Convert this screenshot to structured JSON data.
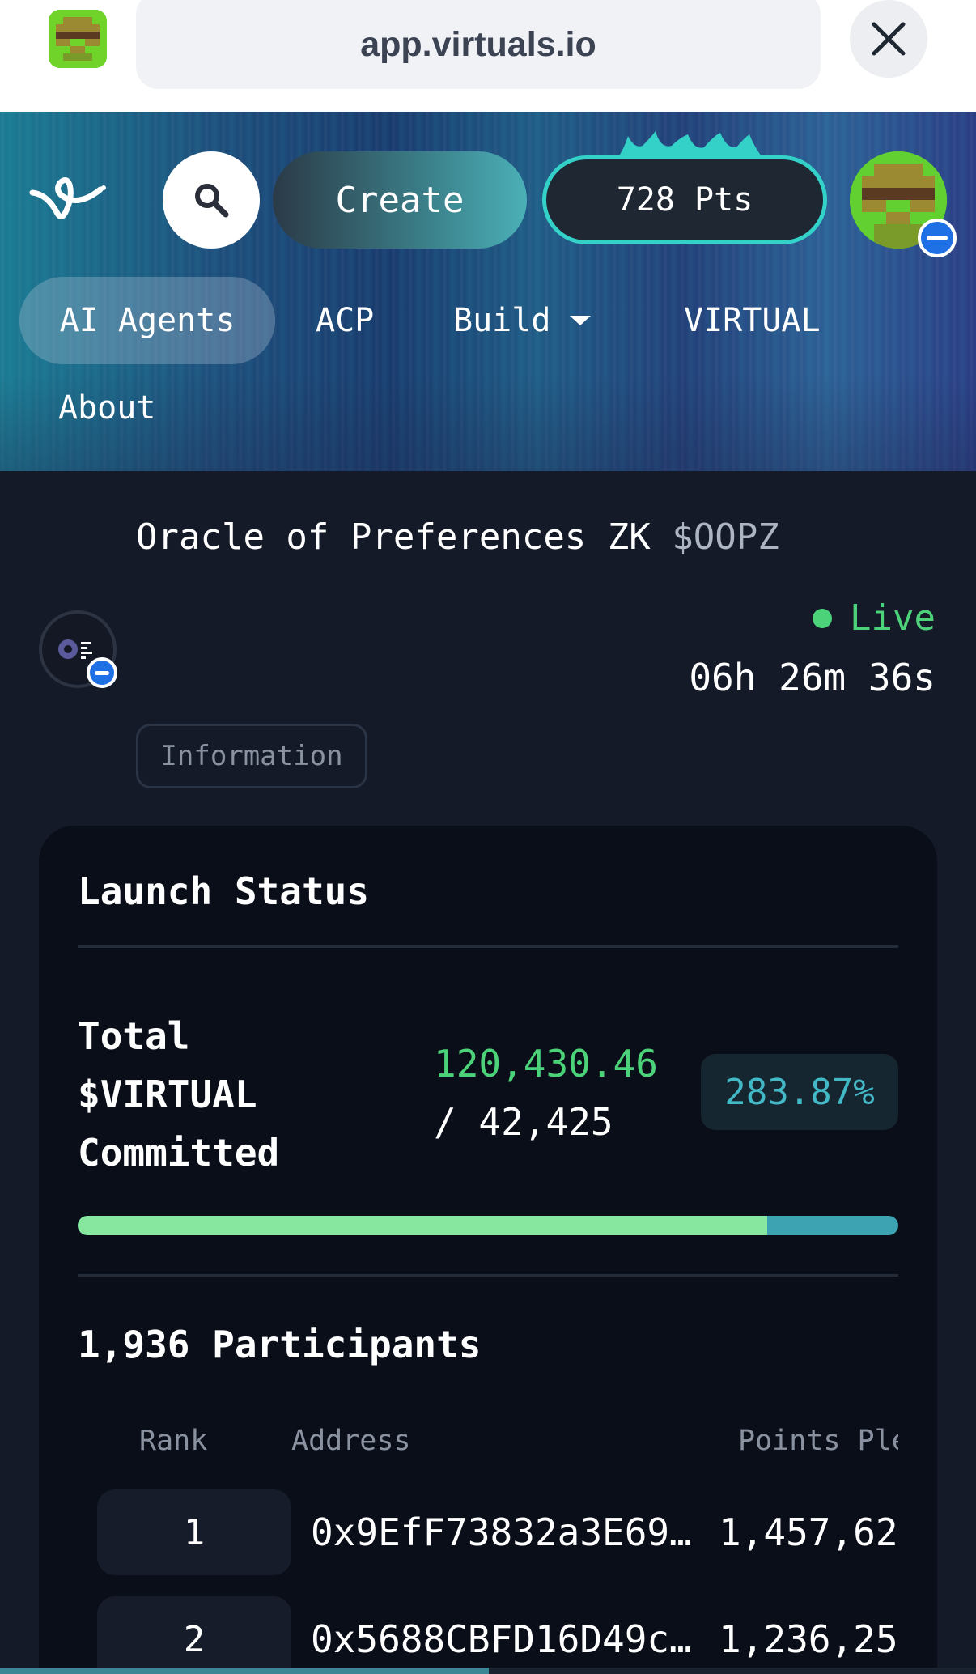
{
  "browser": {
    "url": "app.virtuals.io",
    "close_icon": "close-icon",
    "favicon_icon": "pixel-avatar-icon"
  },
  "header": {
    "logo_icon": "virtuals-logo-icon",
    "search_icon": "search-icon",
    "create_label": "Create",
    "points_label": "728 Pts",
    "avatar_icon": "pixel-avatar-icon",
    "nav": {
      "ai_agents": "AI Agents",
      "acp": "ACP",
      "build": "Build",
      "virtual": "VIRTUAL",
      "about": "About"
    },
    "colors": {
      "points_border": "#34d1c9",
      "create_gradient_end": "#4bb0b7"
    }
  },
  "agent": {
    "name": "Oracle of Preferences ZK",
    "ticker": "$OOPZ",
    "status": "Live",
    "countdown": "06h 26m 36s",
    "info_tab": "Information"
  },
  "launch": {
    "title": "Launch Status",
    "committed_label_lines": [
      "Total",
      "$VIRTUAL",
      "Committed"
    ],
    "committed_amount": "120,430.46",
    "committed_target": "/ 42,425",
    "percent": "283.87%",
    "progress_fraction": 0.84,
    "participants_label": "1,936 Participants",
    "table": {
      "headers": [
        "Rank",
        "Address",
        "Points Ple"
      ],
      "rows": [
        {
          "rank": "1",
          "address": "0x9EfF73832a3E69…",
          "points": "1,457,62"
        },
        {
          "rank": "2",
          "address": "0x5688CBFD16D49c…",
          "points": "1,236,25"
        }
      ]
    },
    "colors": {
      "live": "#4cd37a",
      "percent": "#43b8c6",
      "progress_fill": "#88e79e",
      "progress_track": "#3da3b3"
    }
  }
}
